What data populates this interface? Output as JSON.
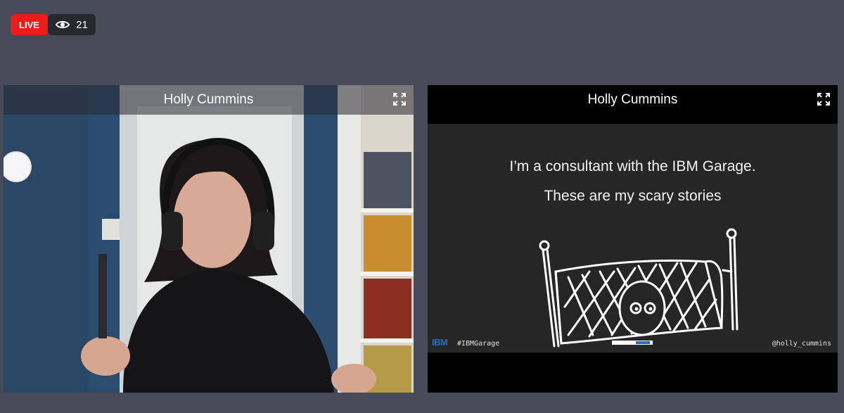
{
  "status": {
    "live_label": "LIVE",
    "viewer_count": "21",
    "viewer_icon": "eye-icon",
    "live_color": "#ea1c1c"
  },
  "panels": [
    {
      "title": "Holly Cummins",
      "expand_icon": "expand-icon"
    },
    {
      "title": "Holly Cummins",
      "expand_icon": "expand-icon"
    }
  ],
  "slide": {
    "line1": "I’m a consultant with the IBM Garage.",
    "line2": "These are my scary stories",
    "footer_brand": "IBM",
    "footer_tag": "#IBMGarage",
    "footer_handle": "@holly_cummins"
  }
}
